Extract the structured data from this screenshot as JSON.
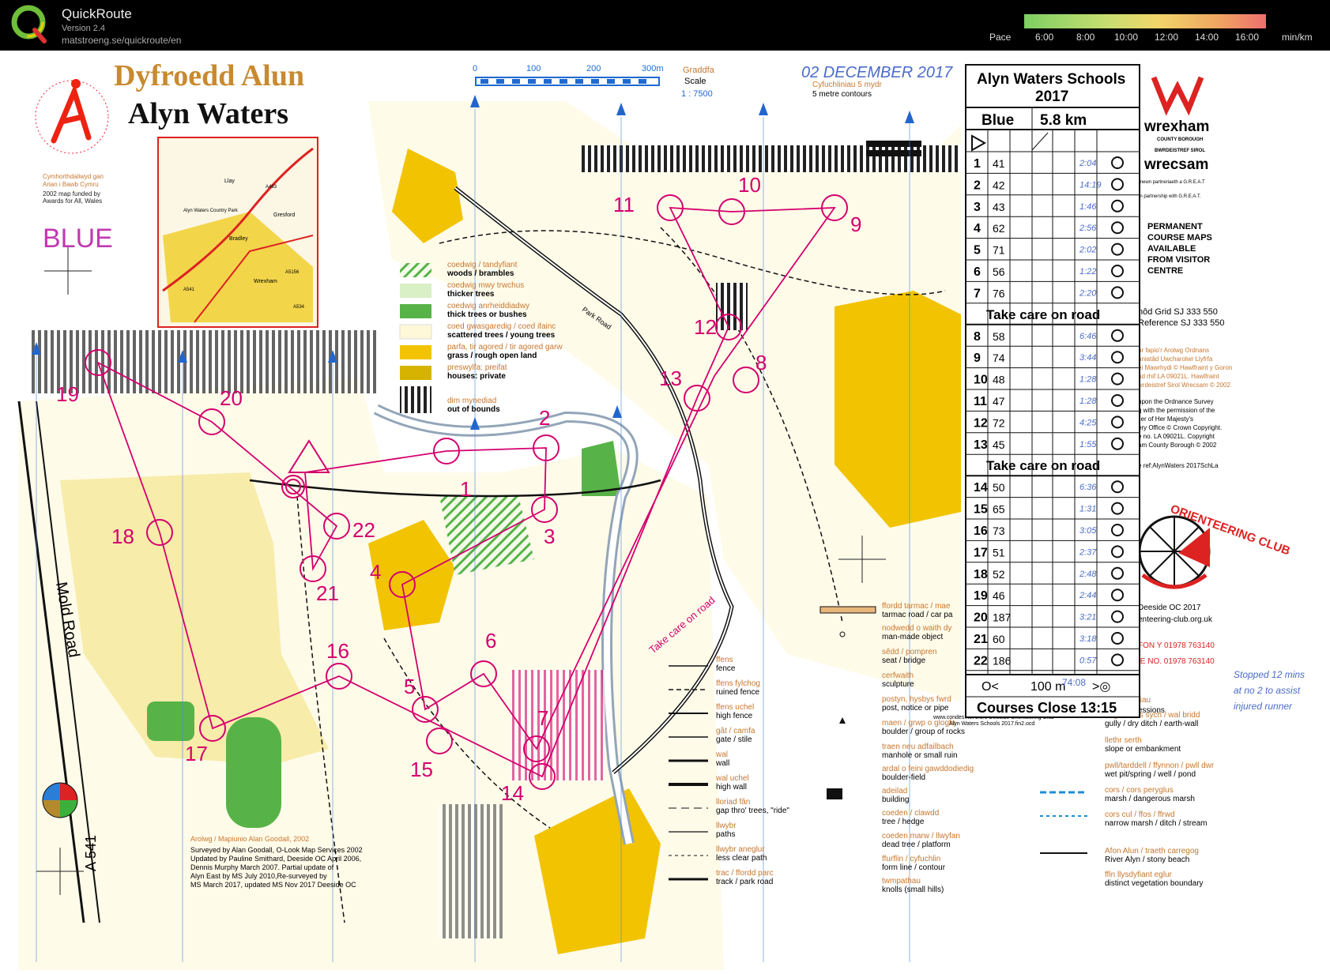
{
  "app": {
    "name": "QuickRoute",
    "version": "Version 2.4",
    "url": "matstroeng.se/quickroute/en",
    "pace_label": "Pace",
    "pace_ticks": [
      "6:00",
      "8:00",
      "10:00",
      "12:00",
      "14:00",
      "16:00"
    ],
    "pace_unit": "min/km",
    "colors": {
      "header_bg": "#000000",
      "course": "#d4006e",
      "woods": "#fffbe9",
      "open": "#f2c300"
    }
  },
  "map": {
    "title_welsh": "Dyfroedd Alun",
    "title": "Alyn Waters",
    "club_arc": "ORIENTEERING CLUB",
    "funding": [
      "Cymhorthdaliwyd gan",
      "Arian i Bawb Cymru",
      "2002 map funded by",
      "Awards for All, Wales"
    ],
    "course_label": "BLUE",
    "scale_ticks": [
      "0",
      "100",
      "200",
      "300m"
    ],
    "scale_title_welsh": "Graddfa",
    "scale_title": "Scale",
    "scale_value": "1 : 7500",
    "handwritten_date": "02 DECEMBER 2017",
    "contours_welsh": "Cyfuchliniau 5 mydr",
    "contours": "5 metre contours",
    "inset_places": [
      "Llay",
      "Alyn Waters Country Park",
      "Bradley",
      "Gresford",
      "Wrexham",
      "A483",
      "A5156",
      "A541",
      "A534"
    ],
    "road_labels": [
      "Park Road",
      "Mold Road",
      "A 541",
      "Take care on road"
    ],
    "legend_main": [
      {
        "welsh": "coedwig / tandyfiant",
        "en": "woods / brambles"
      },
      {
        "welsh": "coedwig mwy trwchus",
        "en": "thicker trees"
      },
      {
        "welsh": "coedwig anrheiddiadwy",
        "en": "thick trees or bushes"
      },
      {
        "welsh": "coed gwasgaredig / coed ifainc",
        "en": "scattered trees / young trees"
      },
      {
        "welsh": "parfa, tir agored / tir agored garw",
        "en": "grass / rough open land"
      },
      {
        "welsh": "preswylfa: preifat",
        "en": "houses: private"
      },
      {
        "welsh": "dim mynediad",
        "en": "out of bounds"
      }
    ],
    "legend_left": [
      {
        "welsh": "ffens",
        "en": "fence"
      },
      {
        "welsh": "ffens fylchog",
        "en": "ruined fence"
      },
      {
        "welsh": "ffens uchel",
        "en": "high fence"
      },
      {
        "welsh": "gât / camfa",
        "en": "gate / stile"
      },
      {
        "welsh": "wal",
        "en": "wall"
      },
      {
        "welsh": "wal uchel",
        "en": "high wall"
      },
      {
        "welsh": "lloriad fân",
        "en": "gap thro' trees, \"ride\""
      },
      {
        "welsh": "llwybr",
        "en": "paths"
      },
      {
        "welsh": "llwybr aneglur",
        "en": "less clear path"
      },
      {
        "welsh": "trac / ffordd parc",
        "en": "track / park road"
      }
    ],
    "legend_middle": [
      {
        "welsh": "ffordd tarmac / mae",
        "en": "tarmac road / car pa"
      },
      {
        "welsh": "nodwedd o waith dy",
        "en": "man-made object"
      },
      {
        "welsh": "sêdd / pompren",
        "en": "seat / bridge"
      },
      {
        "welsh": "cerfwaith",
        "en": "sculpture"
      },
      {
        "welsh": "postyn, hysbys fwrd",
        "en": "post, notice or pipe"
      },
      {
        "welsh": "maen / grwp o glogfa",
        "en": "boulder / group of rocks"
      },
      {
        "welsh": "traen neu adfailbach",
        "en": "manhole or small ruin"
      },
      {
        "welsh": "ardal o feini gawddodiedig",
        "en": "boulder-field"
      },
      {
        "welsh": "adeilad",
        "en": "building"
      },
      {
        "welsh": "coeden / clawdd",
        "en": "tree / hedge"
      },
      {
        "welsh": "coeden marw / llwyfan",
        "en": "dead tree / platform"
      },
      {
        "welsh": "ffurflin / cyfuchlin",
        "en": "form line / contour"
      },
      {
        "welsh": "twmpathau",
        "en": "knolls (small hills)"
      }
    ],
    "legend_right": [
      {
        "welsh": "rhigol / ffôs sych / wal bridd",
        "en": "gully / dry ditch / earth-wall"
      },
      {
        "welsh": "llethr serth",
        "en": "slope or embankment"
      },
      {
        "welsh": "pwll/tarddell / ffynnon / pwll dwr",
        "en": "wet pit/spring / well / pond"
      },
      {
        "welsh": "cors / cors peryglus",
        "en": "marsh / dangerous marsh"
      },
      {
        "welsh": "cors cul / ffos / ffrwd",
        "en": "narrow marsh / ditch / stream"
      },
      {
        "welsh": "Afon Alun / traeth carregog",
        "en": "River Alyn / stony beach"
      },
      {
        "welsh": "ffin llysdyfiant eglur",
        "en": "distinct vegetation boundary"
      }
    ],
    "credits": [
      "Arolwg / Mapiunio Alan Goodall, 2002",
      "Surveyed by Alan Goodall, O-Look Map Services 2002",
      "Updated by Pauline Smithard, Deeside OC April 2006,",
      "Dennis Murphy March 2007. Partial update of",
      "Alyn East by MS July 2010,Re-surveyed by",
      "MS March 2017, updated MS Nov 2017 Deeside OC"
    ],
    "condes": "www.condes.net 9.3.6 Deeside Orienteering Club",
    "condes2": "Alyn Waters Schools 2017.fin2.ocd",
    "wrexham": [
      "wrexham",
      "COUNTY BOROUGH",
      "BWRDEISTREF SIROL",
      "wrecsam"
    ],
    "partnership": [
      "mewn partneriaeth a G.R.E.A.T",
      "in partnership with G.R.E.A.T."
    ],
    "permanent": [
      "PERMANENT",
      "COURSE MAPS",
      "AVAILABLE",
      "FROM VISITOR",
      "CENTRE"
    ],
    "side_notes": [
      "nôd Grid SJ 333 550",
      "Reference SJ 333 550",
      "ar fapio'r Arolwg Ordnans",
      "aniatâd Uwcharolwr Llyfrfa",
      "ei Mawrhydi © Hawlfraint y Goron",
      "nd rhif LA 09021L. Hawlfraint",
      "wrdeistref Sirol Wrecsam © 2002",
      "upon the Ordnance Survey",
      "g with the permission of the",
      "ller of  Her Majesty's",
      "ery Office © Crown Copyright.",
      "e no. LA 09021L. Copyright",
      "am County Borough © 2002",
      "e ref:AlynWaters 2017SchLa"
    ],
    "club_info": [
      "Deeside OC 2017",
      "enteering-club.org.uk",
      "FON Y 01978 763140",
      "IE NO.  01978 763140",
      "tiau",
      "essions"
    ],
    "handwritten_notes": [
      "Stopped 12 mins",
      "at no 2 to assist",
      "injured runner"
    ],
    "control_numbers": [
      "1",
      "2",
      "3",
      "4",
      "5",
      "6",
      "7",
      "8",
      "9",
      "10",
      "11",
      "12",
      "13",
      "14",
      "15",
      "16",
      "17",
      "18",
      "19",
      "20",
      "21",
      "22"
    ]
  },
  "description_sheet": {
    "title": "Alyn Waters Schools",
    "year": "2017",
    "course": "Blue",
    "length": "5.8 km",
    "section_notes": [
      "Take care on road",
      "Take care on road"
    ],
    "rows": [
      {
        "num": "1",
        "code": "41",
        "split": "2:04"
      },
      {
        "num": "2",
        "code": "42",
        "split": "14:19"
      },
      {
        "num": "3",
        "code": "43",
        "split": "1:46"
      },
      {
        "num": "4",
        "code": "62",
        "split": "2:56"
      },
      {
        "num": "5",
        "code": "71",
        "split": "2:02"
      },
      {
        "num": "6",
        "code": "56",
        "split": "1:22"
      },
      {
        "num": "7",
        "code": "76",
        "split": "2:20"
      },
      {
        "num": "8",
        "code": "58",
        "split": "6:46"
      },
      {
        "num": "9",
        "code": "74",
        "split": "3:44"
      },
      {
        "num": "10",
        "code": "48",
        "split": "1:28"
      },
      {
        "num": "11",
        "code": "47",
        "split": "1:28"
      },
      {
        "num": "12",
        "code": "72",
        "split": "4:25"
      },
      {
        "num": "13",
        "code": "45",
        "split": "1:55"
      },
      {
        "num": "14",
        "code": "50",
        "split": "6:36"
      },
      {
        "num": "15",
        "code": "65",
        "split": "1:31"
      },
      {
        "num": "16",
        "code": "73",
        "split": "3:05"
      },
      {
        "num": "17",
        "code": "51",
        "split": "2:37"
      },
      {
        "num": "18",
        "code": "52",
        "split": "2:48"
      },
      {
        "num": "19",
        "code": "46",
        "split": "2:44"
      },
      {
        "num": "20",
        "code": "187",
        "split": "3:21"
      },
      {
        "num": "21",
        "code": "60",
        "split": "3:18"
      },
      {
        "num": "22",
        "code": "186",
        "split": "0:57"
      }
    ],
    "finish_distance": "100 m",
    "finish_time": "74:08",
    "courses_close": "Courses Close 13:15"
  }
}
